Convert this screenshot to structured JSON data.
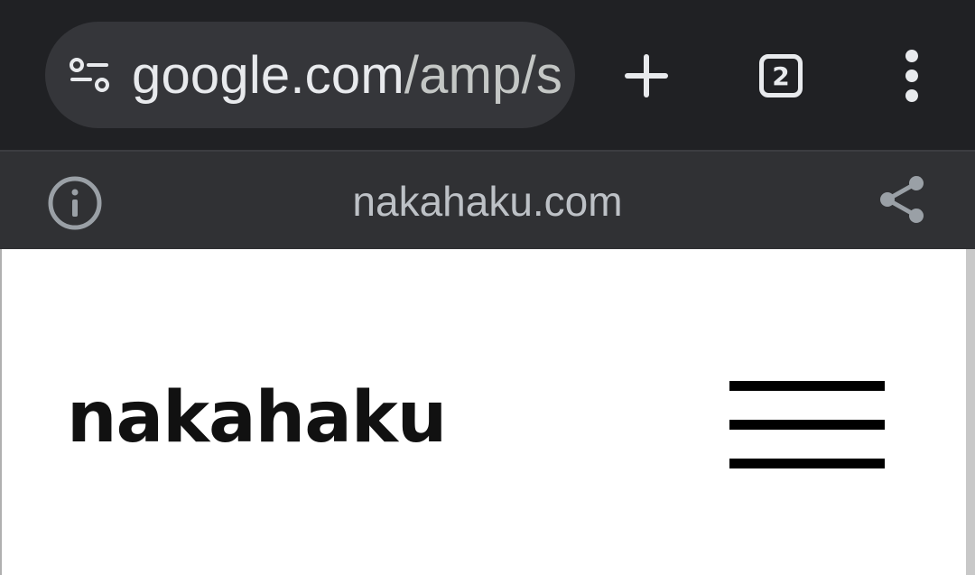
{
  "browser": {
    "url_main": "google.com",
    "url_path": "/amp/s",
    "tab_count": "2",
    "icons": {
      "site_settings": "tune-icon",
      "new_tab": "plus-icon",
      "tab_switcher": "tab-count-icon",
      "menu": "more-vert-icon"
    }
  },
  "amp_bar": {
    "domain": "nakahaku.com",
    "icons": {
      "info": "info-icon",
      "share": "share-icon"
    }
  },
  "page": {
    "site_title": "nakahaku",
    "menu_icon": "hamburger-menu-icon"
  },
  "colors": {
    "toolbar_bg": "#202124",
    "omnibox_bg": "#35363a",
    "amp_bar_bg": "#303134",
    "page_bg": "#ffffff",
    "title_color": "#111111"
  }
}
